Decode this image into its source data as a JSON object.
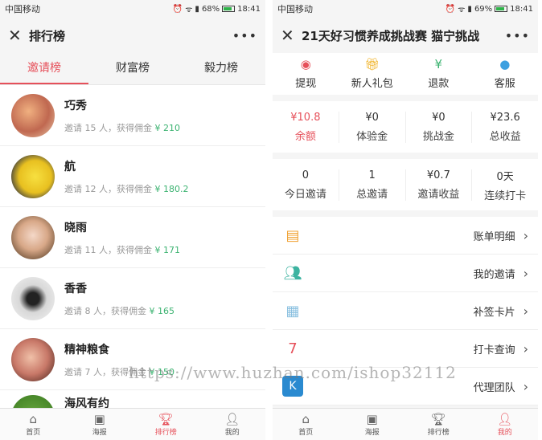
{
  "left": {
    "status": {
      "carrier": "中国移动",
      "battery": "68%",
      "time": "18:41"
    },
    "title": "排行榜",
    "tabs": [
      "邀请榜",
      "财富榜",
      "毅力榜"
    ],
    "rows": [
      {
        "name": "巧秀",
        "invite_prefix": "邀请",
        "count": "15",
        "suffix": "人，获得佣金",
        "amount": "¥ 210"
      },
      {
        "name": "航",
        "invite_prefix": "邀请",
        "count": "12",
        "suffix": "人，获得佣金",
        "amount": "¥ 180.2"
      },
      {
        "name": "晓雨",
        "invite_prefix": "邀请",
        "count": "11",
        "suffix": "人，获得佣金",
        "amount": "¥ 171"
      },
      {
        "name": "香香",
        "invite_prefix": "邀请",
        "count": "8",
        "suffix": "人，获得佣金",
        "amount": "¥ 165"
      },
      {
        "name": "精神粮食",
        "invite_prefix": "邀请",
        "count": "7",
        "suffix": "人，获得佣金",
        "amount": "¥ 150"
      },
      {
        "name": "海风有约",
        "invite_prefix": "",
        "count": "",
        "suffix": "",
        "amount": ""
      }
    ],
    "tabbar": [
      "首页",
      "海报",
      "排行榜",
      "我的"
    ]
  },
  "right": {
    "status": {
      "carrier": "中国移动",
      "battery": "69%",
      "time": "18:41"
    },
    "title": "21天好习惯养成挑战赛 猫宁挑战",
    "shortcuts": [
      "提现",
      "新人礼包",
      "退款",
      "客服"
    ],
    "stats1": [
      {
        "value": "¥10.8",
        "label": "余额"
      },
      {
        "value": "¥0",
        "label": "体验金"
      },
      {
        "value": "¥0",
        "label": "挑战金"
      },
      {
        "value": "¥23.6",
        "label": "总收益"
      }
    ],
    "stats2": [
      {
        "value": "0",
        "label": "今日邀请"
      },
      {
        "value": "1",
        "label": "总邀请"
      },
      {
        "value": "¥0.7",
        "label": "邀请收益"
      },
      {
        "value": "0天",
        "label": "连续打卡"
      }
    ],
    "menu": [
      "账单明细",
      "我的邀请",
      "补签卡片",
      "打卡查询",
      "代理团队"
    ],
    "tabbar": [
      "首页",
      "海报",
      "排行榜",
      "我的"
    ]
  },
  "watermark": "https://www.huzhan.com/ishop32112",
  "colors": {
    "accent": "#e6505a",
    "money": "#3cb371"
  }
}
